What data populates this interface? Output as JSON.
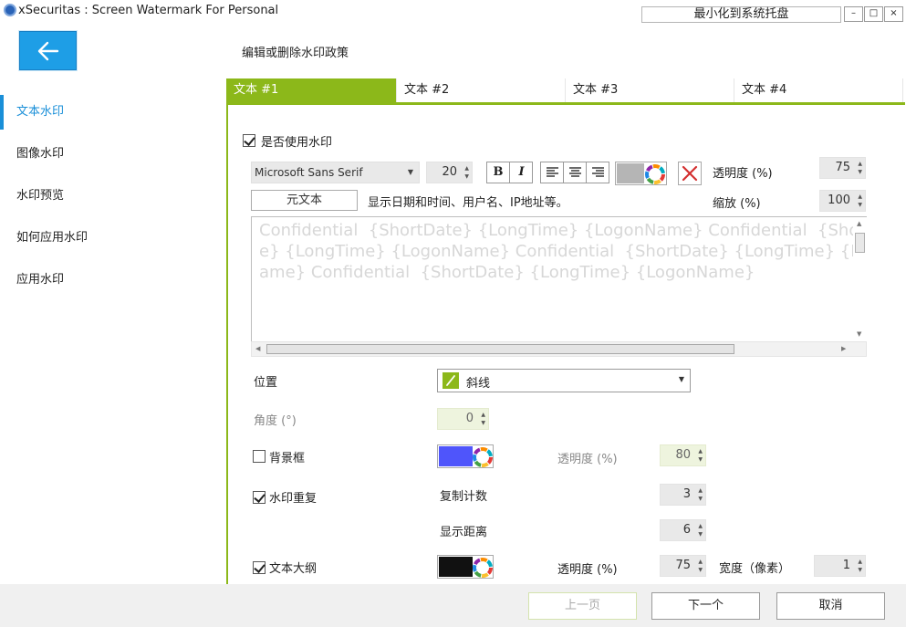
{
  "window": {
    "title": "xSecuritas : Screen Watermark For Personal",
    "title_suffix": "..",
    "minimize_to_tray": "最小化到系统托盘",
    "min_glyph": "–",
    "max_glyph": "□",
    "close_glyph": "×"
  },
  "header": {
    "title": "编辑或删除水印政策"
  },
  "sidebar": {
    "items": [
      {
        "label": "文本水印",
        "active": true
      },
      {
        "label": "图像水印"
      },
      {
        "label": "水印预览"
      },
      {
        "label": "如何应用水印"
      },
      {
        "label": "应用水印"
      }
    ]
  },
  "tabs": [
    {
      "label": "文本 #1",
      "active": true
    },
    {
      "label": "文本 #2"
    },
    {
      "label": "文本 #3"
    },
    {
      "label": "文本 #4"
    }
  ],
  "text_tab": {
    "use_watermark_label": "是否使用水印",
    "use_watermark_checked": true,
    "font_family": "Microsoft Sans Serif",
    "font_size": "20",
    "bold_glyph": "B",
    "italic_glyph": "I",
    "text_color": "#b5b5b5",
    "opacity_label": "透明度 (%)",
    "opacity_value": "75",
    "meta_text_button": "元文本",
    "meta_text_hint": "显示日期和时间、用户名、IP地址等。",
    "scale_label": "缩放 (%)",
    "scale_value": "100",
    "watermark_text": "Confidential  {ShortDate} {LongTime} {LogonName} Confidential  {ShortDate} {LongTime} {LogonName} Confidential  {ShortDate} {LongTime} {LogonName} Confidential  {ShortDate} {LongTime} {LogonName}",
    "position_label": "位置",
    "position_value": "斜线",
    "angle_label": "角度 (°)",
    "angle_value": "0",
    "background_box_label": "背景框",
    "background_box_checked": false,
    "background_color": "#4f55fb",
    "bg_opacity_label": "透明度 (%)",
    "bg_opacity_value": "80",
    "repeat_label": "水印重复",
    "repeat_checked": true,
    "copy_count_label": "复制计数",
    "copy_count_value": "3",
    "display_distance_label": "显示距离",
    "display_distance_value": "6",
    "outline_label": "文本大纲",
    "outline_checked": true,
    "outline_color": "#111111",
    "outline_opacity_label": "透明度 (%)",
    "outline_opacity_value": "75",
    "outline_width_label": "宽度（像素）",
    "outline_width_value": "1"
  },
  "footer": {
    "prev_label": "上一页",
    "next_label": "下一个",
    "cancel_label": "取消"
  },
  "colors": {
    "accent_green": "#8cb81a",
    "accent_blue": "#1a8fd8"
  }
}
